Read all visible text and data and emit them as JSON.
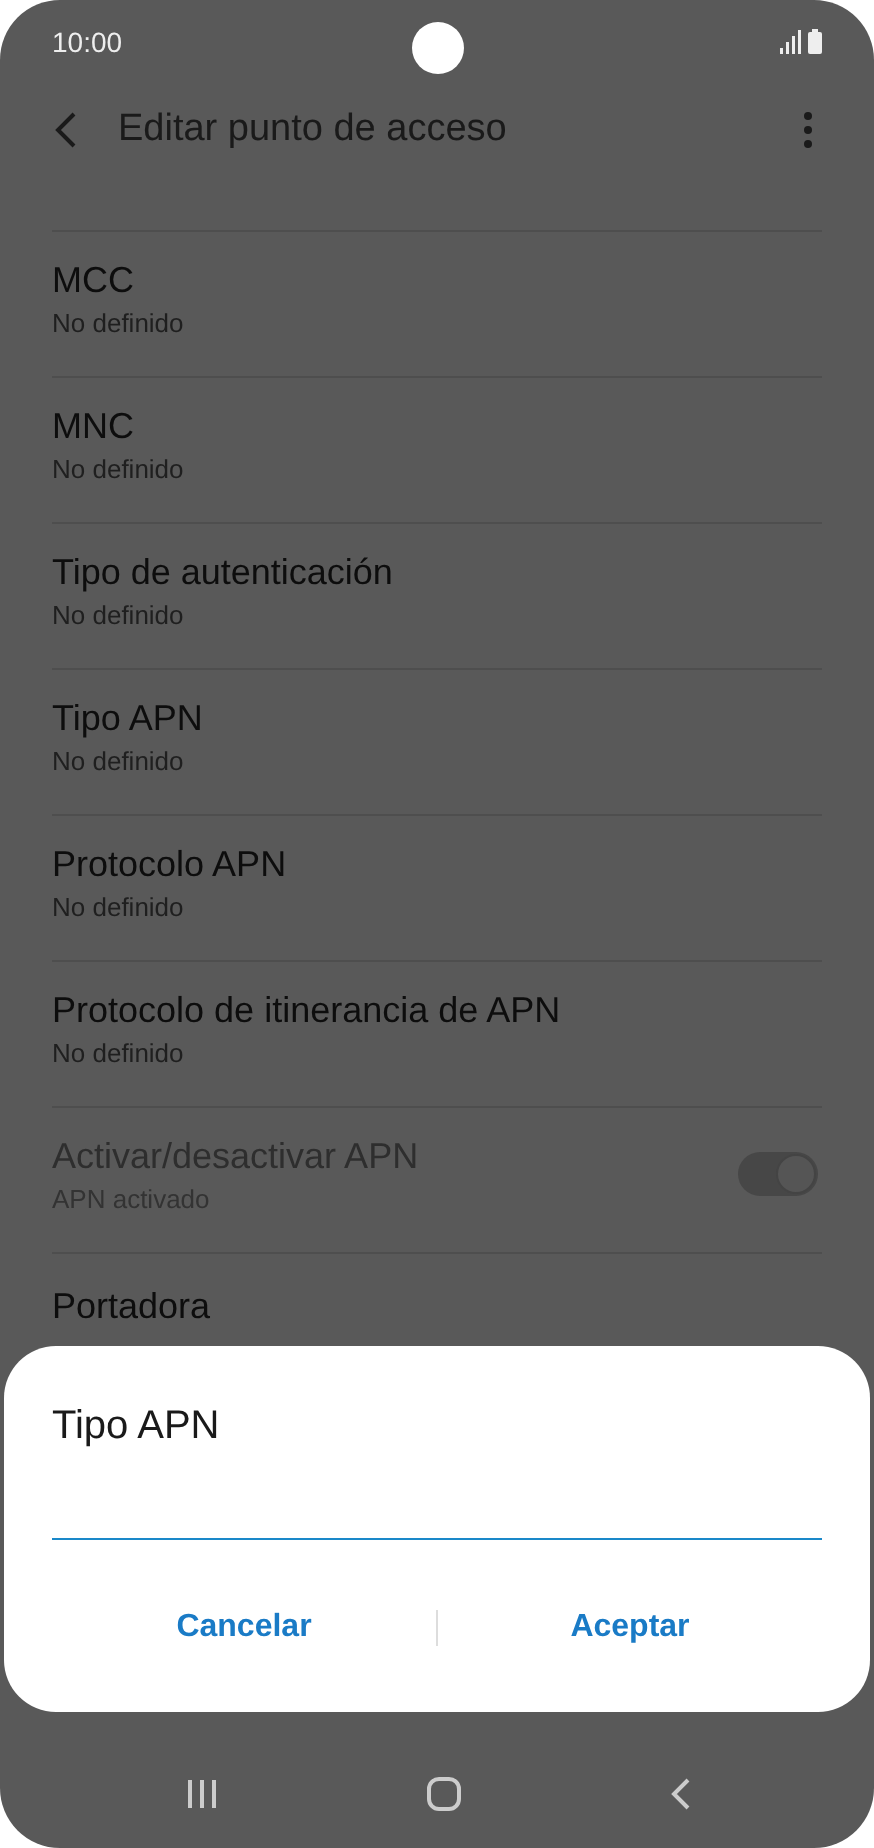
{
  "status_bar": {
    "time": "10:00"
  },
  "header": {
    "title": "Editar punto de acceso"
  },
  "settings": [
    {
      "kind": "text",
      "title": "MCC",
      "subtitle": "No definido",
      "disabled": false
    },
    {
      "kind": "text",
      "title": "MNC",
      "subtitle": "No definido",
      "disabled": false
    },
    {
      "kind": "text",
      "title": "Tipo de autenticación",
      "subtitle": "No definido",
      "disabled": false
    },
    {
      "kind": "text",
      "title": "Tipo APN",
      "subtitle": "No definido",
      "disabled": false
    },
    {
      "kind": "text",
      "title": "Protocolo APN",
      "subtitle": "No definido",
      "disabled": false
    },
    {
      "kind": "text",
      "title": "Protocolo de itinerancia de APN",
      "subtitle": "No definido",
      "disabled": false
    },
    {
      "kind": "toggle",
      "title": "Activar/desactivar APN",
      "subtitle": "APN activado",
      "disabled": true,
      "on": true
    },
    {
      "kind": "text",
      "title": "Portadora",
      "disabled": false
    }
  ],
  "dialog": {
    "title": "Tipo APN",
    "buttons": [
      "Cancelar",
      "Aceptar"
    ]
  }
}
